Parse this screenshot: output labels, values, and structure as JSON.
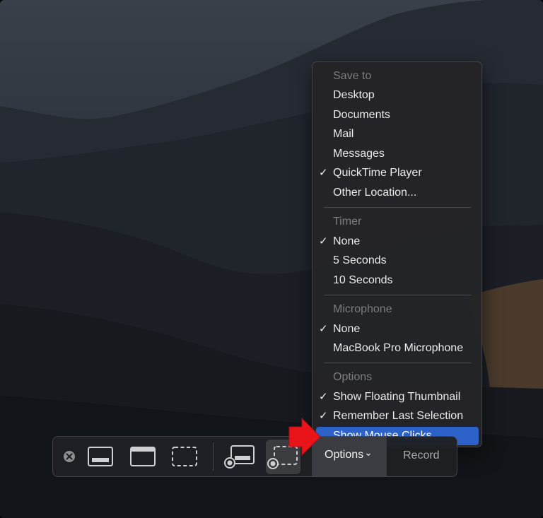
{
  "menu": {
    "sections": [
      {
        "header": "Save to",
        "items": [
          {
            "label": "Desktop",
            "checked": false
          },
          {
            "label": "Documents",
            "checked": false
          },
          {
            "label": "Mail",
            "checked": false
          },
          {
            "label": "Messages",
            "checked": false
          },
          {
            "label": "QuickTime Player",
            "checked": true
          },
          {
            "label": "Other Location...",
            "checked": false
          }
        ]
      },
      {
        "header": "Timer",
        "items": [
          {
            "label": "None",
            "checked": true
          },
          {
            "label": "5 Seconds",
            "checked": false
          },
          {
            "label": "10 Seconds",
            "checked": false
          }
        ]
      },
      {
        "header": "Microphone",
        "items": [
          {
            "label": "None",
            "checked": true
          },
          {
            "label": "MacBook Pro Microphone",
            "checked": false
          }
        ]
      },
      {
        "header": "Options",
        "items": [
          {
            "label": "Show Floating Thumbnail",
            "checked": true
          },
          {
            "label": "Remember Last Selection",
            "checked": true
          },
          {
            "label": "Show Mouse Clicks",
            "checked": false,
            "highlighted": true
          }
        ]
      }
    ],
    "check_glyph": "✓"
  },
  "toolbar": {
    "tools": [
      {
        "name": "close",
        "icon": "close-circle-icon",
        "selected": false
      },
      {
        "name": "capture-entire-screen",
        "icon": "screen-icon",
        "selected": false
      },
      {
        "name": "capture-selected-window",
        "icon": "window-icon",
        "selected": false
      },
      {
        "name": "capture-selected-portion",
        "icon": "dashed-rect-icon",
        "selected": false
      },
      {
        "name": "record-entire-screen",
        "icon": "screen-record-icon",
        "selected": false
      },
      {
        "name": "record-selected-portion",
        "icon": "dashed-rect-record-icon",
        "selected": true
      }
    ],
    "options_label": "Options",
    "options_chevron": "⌄",
    "record_label": "Record"
  },
  "colors": {
    "highlight": "#2c62c8",
    "pointer_arrow": "#e8141a"
  }
}
